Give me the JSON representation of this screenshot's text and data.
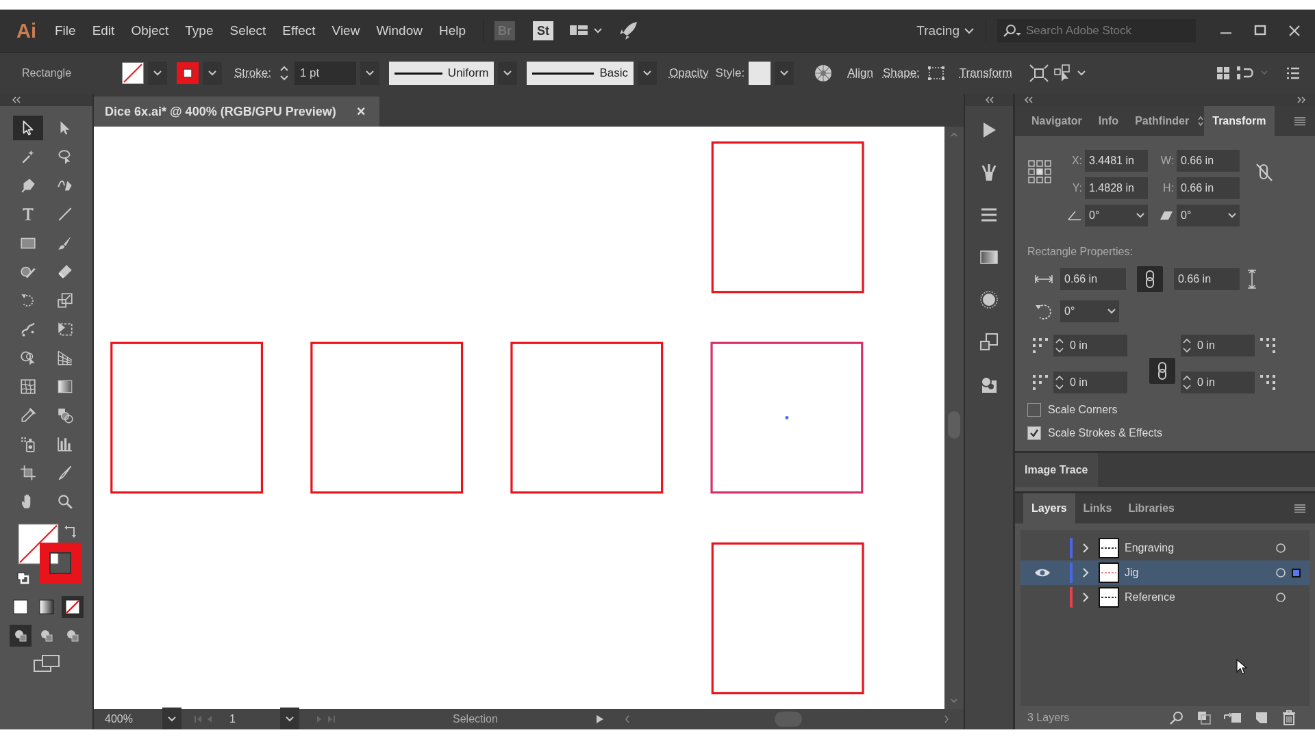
{
  "app_logo": "Ai",
  "menu": [
    "File",
    "Edit",
    "Object",
    "Type",
    "Select",
    "Effect",
    "View",
    "Window",
    "Help"
  ],
  "bridge_button": "Br",
  "stock_button": "St",
  "workspace": {
    "label": "Tracing"
  },
  "search": {
    "placeholder": "Search Adobe Stock"
  },
  "control_bar": {
    "tool_name": "Rectangle",
    "swatches": [
      {
        "kind": "none"
      },
      {
        "kind": "solid",
        "color": "#e8141c"
      }
    ],
    "stroke_label": "Stroke:",
    "stroke_weight": "1 pt",
    "variable_width": "Uniform",
    "brush": "Basic",
    "opacity_label": "Opacity",
    "style_label": "Style:",
    "align_label": "Align",
    "shape_label": "Shape:",
    "transform_label": "Transform"
  },
  "document_tab": {
    "title": "Dice 6x.ai* @ 400% (RGB/GPU Preview)",
    "close": "×"
  },
  "tools": [
    {
      "kind": "selection",
      "selected": true
    },
    {
      "kind": "direct-selection",
      "selected": false
    },
    {
      "kind": "magic-wand",
      "selected": false
    },
    {
      "kind": "lasso",
      "selected": false
    },
    {
      "kind": "pen",
      "selected": false
    },
    {
      "kind": "curvature",
      "selected": false
    },
    {
      "kind": "type",
      "selected": false
    },
    {
      "kind": "line",
      "selected": false
    },
    {
      "kind": "rectangle",
      "selected": false
    },
    {
      "kind": "paintbrush",
      "selected": false
    },
    {
      "kind": "shaper",
      "selected": false
    },
    {
      "kind": "eraser",
      "selected": false
    },
    {
      "kind": "rotate",
      "selected": false
    },
    {
      "kind": "scale",
      "selected": false
    },
    {
      "kind": "puppet-warp",
      "selected": false
    },
    {
      "kind": "free-transform",
      "selected": false
    },
    {
      "kind": "shape-builder",
      "selected": false
    },
    {
      "kind": "perspective-grid",
      "selected": false
    },
    {
      "kind": "mesh",
      "selected": false
    },
    {
      "kind": "gradient",
      "selected": false
    },
    {
      "kind": "eyedropper",
      "selected": false
    },
    {
      "kind": "blend",
      "selected": false
    },
    {
      "kind": "symbol-sprayer",
      "selected": false
    },
    {
      "kind": "graph",
      "selected": false
    },
    {
      "kind": "artboard",
      "selected": false
    },
    {
      "kind": "slice",
      "selected": false
    },
    {
      "kind": "hand",
      "selected": false
    },
    {
      "kind": "zoom",
      "selected": false
    }
  ],
  "color_modes": [
    {
      "kind": "color",
      "selected": false
    },
    {
      "kind": "gradient",
      "selected": false
    },
    {
      "kind": "none",
      "selected": true
    }
  ],
  "draw_modes": [
    {
      "selected": true
    },
    {
      "selected": false
    },
    {
      "selected": false
    }
  ],
  "artboard": {
    "shapes": [
      {
        "selected": false
      },
      {
        "selected": false
      },
      {
        "selected": false
      },
      {
        "selected": false
      },
      {
        "selected": true
      },
      {
        "selected": false
      }
    ]
  },
  "transform_panel": {
    "tabs": [
      {
        "label": "Navigator",
        "selected": false
      },
      {
        "label": "Info",
        "selected": false
      },
      {
        "label": "Pathfinder",
        "selected": false
      },
      {
        "label": "Transform",
        "selected": true
      }
    ],
    "fields": [
      {
        "label": "X:",
        "value": "3.4481 in"
      },
      {
        "label": "W:",
        "value": "0.66 in"
      },
      {
        "label": "Y:",
        "value": "1.4828 in"
      },
      {
        "label": "H:",
        "value": "0.66 in"
      }
    ],
    "angle": "0°",
    "shear": "0°",
    "section_title": "Rectangle Properties:",
    "rect_width": "0.66 in",
    "rect_height": "0.66 in",
    "rect_angle": "0°",
    "corners": [
      "0 in",
      "0 in",
      "0 in",
      "0 in"
    ],
    "options": [
      {
        "label": "Scale Corners",
        "checked": false
      },
      {
        "label": "Scale Strokes & Effects",
        "checked": true
      }
    ]
  },
  "image_trace": {
    "title": "Image Trace"
  },
  "layers_panel": {
    "tabs": [
      {
        "label": "Layers",
        "selected": true
      },
      {
        "label": "Links",
        "selected": false
      },
      {
        "label": "Libraries",
        "selected": false
      }
    ],
    "layers": [
      {
        "name": "Engraving",
        "color": "#4a66e8",
        "visible": false,
        "selected": false
      },
      {
        "name": "Jig",
        "color": "#4a66e8",
        "visible": true,
        "selected": true
      },
      {
        "name": "Reference",
        "color": "#e8404c",
        "visible": false,
        "selected": false
      }
    ],
    "count": "3 Layers"
  },
  "status_bar": {
    "zoom": "400%",
    "artboard": "1",
    "tool": "Selection"
  }
}
